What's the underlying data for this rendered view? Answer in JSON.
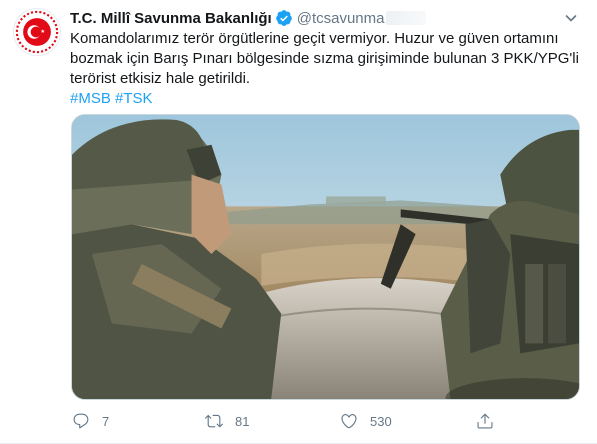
{
  "tweet": {
    "author": {
      "display_name": "T.C. Millî Savunma Bakanlığı",
      "handle": "@tcsavunma",
      "verified": true,
      "avatar_icon": "ministry-emblem-icon"
    },
    "text_lines": [
      "Komandolarımız terör örgütlerine geçit vermiyor. Huzur ve güven ortamını",
      "bozmak için Barış Pınarı bölgesinde sızma girişiminde bulunan 3 PKK/YPG'li",
      "terörist etkisiz hale getirildi."
    ],
    "hashtags": [
      "#MSB",
      "#TSK"
    ],
    "media": {
      "kind": "photo",
      "subject": "soldiers-observing-landscape"
    },
    "actions": {
      "reply": {
        "icon": "reply-icon",
        "count": "7"
      },
      "retweet": {
        "icon": "retweet-icon",
        "count": "81"
      },
      "like": {
        "icon": "heart-icon",
        "count": "530"
      },
      "share": {
        "icon": "share-icon"
      }
    },
    "menu_icon": "chevron-down-icon"
  },
  "colors": {
    "text_primary": "#14171a",
    "text_secondary": "#657786",
    "link": "#1da1f2",
    "verified": "#1da1f2",
    "emblem_red": "#e30a17",
    "border": "#e6ecf0"
  }
}
